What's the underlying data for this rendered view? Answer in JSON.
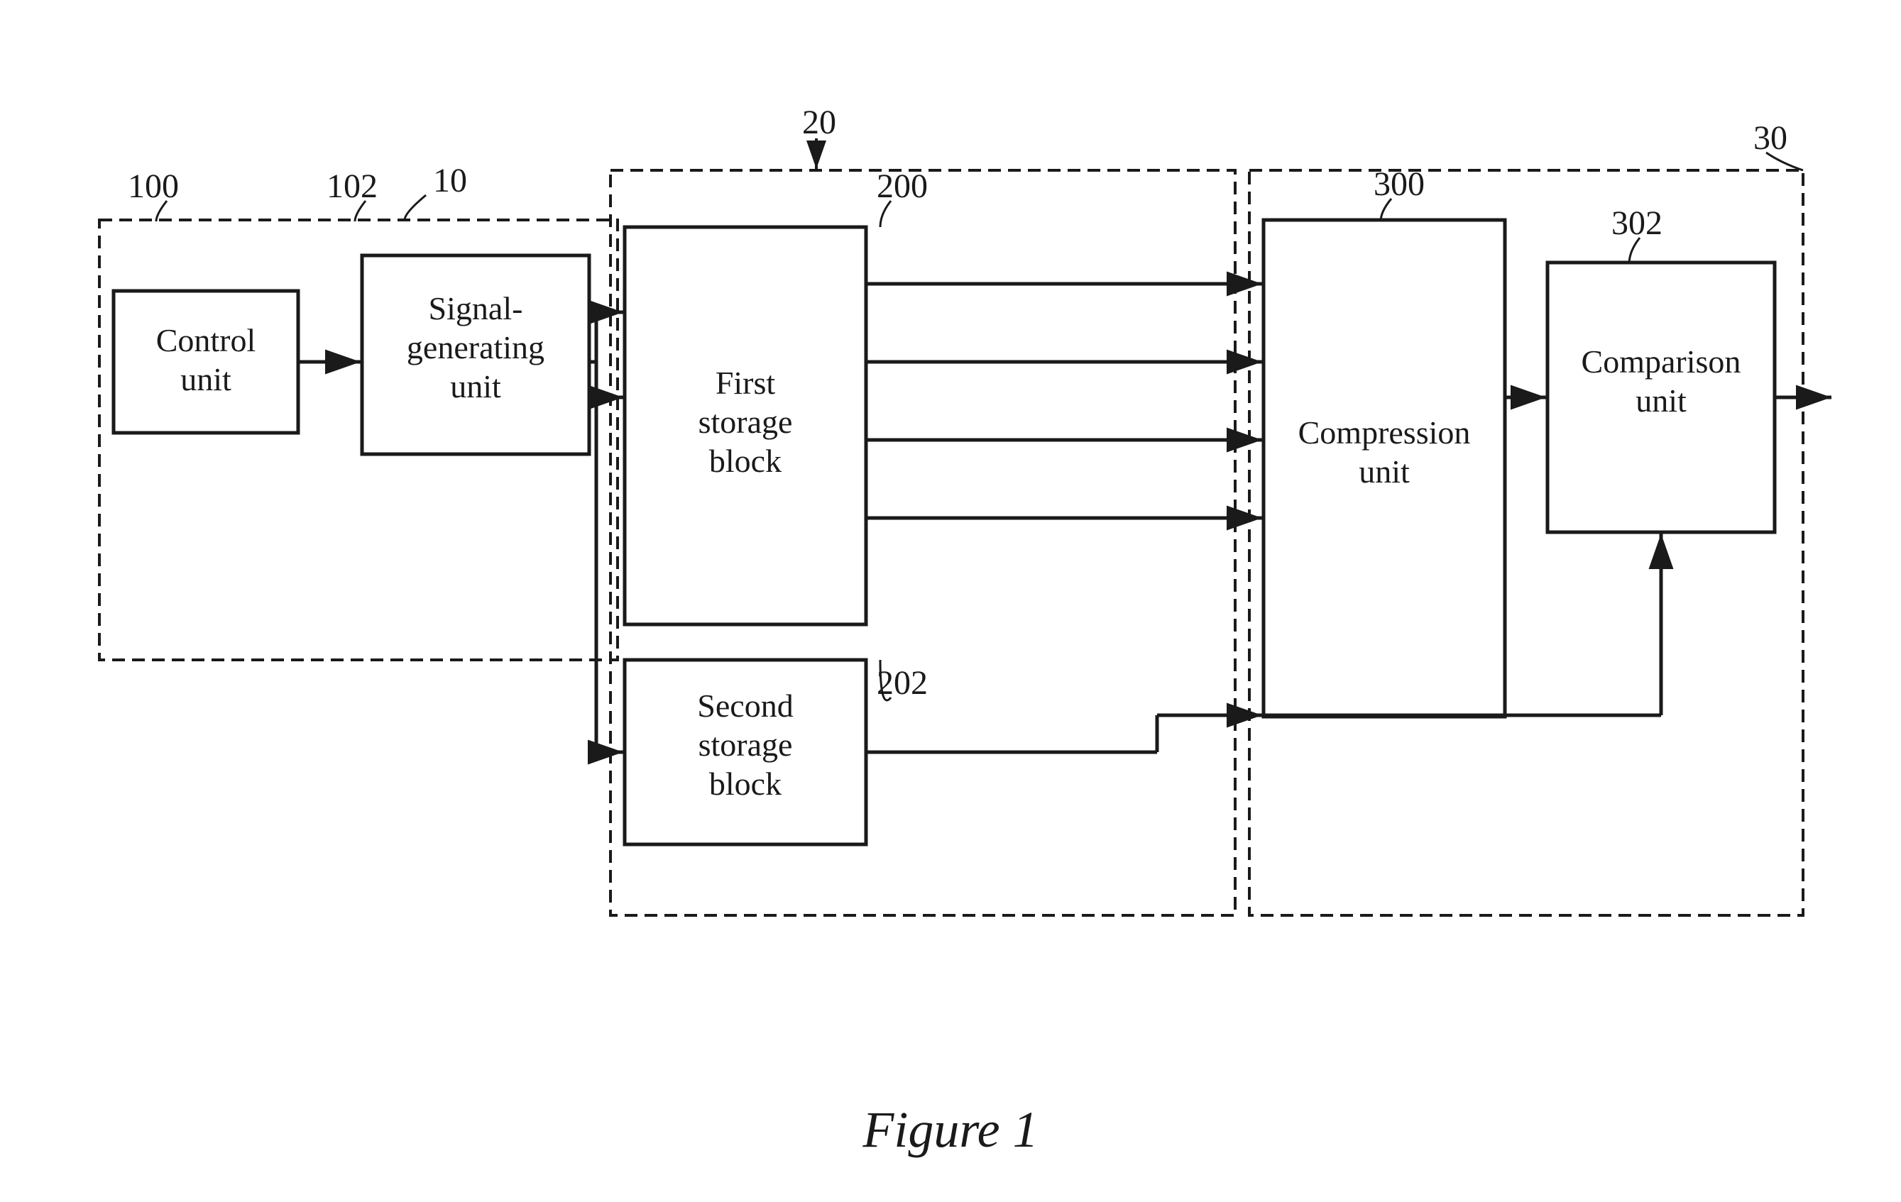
{
  "diagram": {
    "title": "Figure 1",
    "labels": {
      "ref_20": "20",
      "ref_10": "10",
      "ref_100": "100",
      "ref_102": "102",
      "ref_200": "200",
      "ref_202": "202",
      "ref_300": "300",
      "ref_302": "302",
      "ref_30": "30",
      "control_unit": "Control unit",
      "signal_generating_unit": "Signal-generating unit",
      "first_storage_block": "First storage block",
      "second_storage_block": "Second storage block",
      "compression_unit": "Compression unit",
      "comparison_unit": "Comparison unit"
    }
  },
  "caption": "Figure 1"
}
